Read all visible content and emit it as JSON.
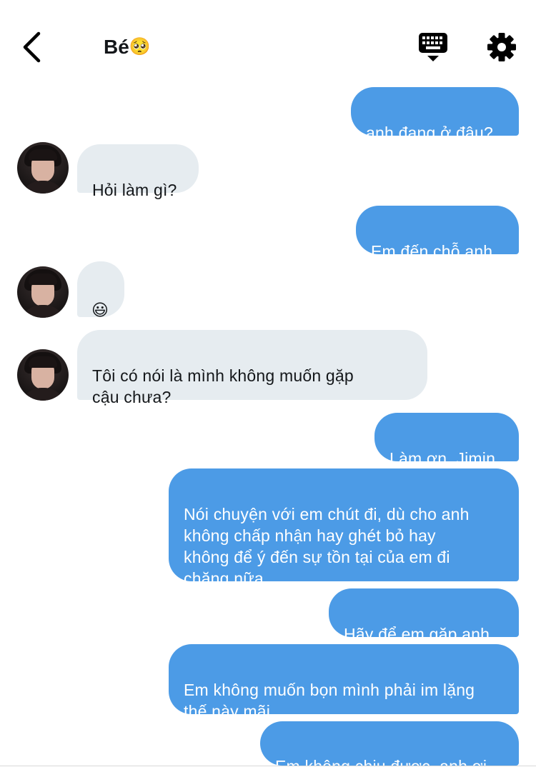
{
  "header": {
    "title": "Bé",
    "title_emoji": "🥺",
    "back_icon": "chevron-left-icon",
    "keyboard_icon": "keyboard-icon",
    "settings_icon": "gear-icon"
  },
  "messages": [
    {
      "direction": "out",
      "text": "anh đang ở đâu?"
    },
    {
      "direction": "in",
      "text": "Hỏi làm gì?"
    },
    {
      "direction": "out",
      "text": "Em đến chỗ anh"
    },
    {
      "direction": "in",
      "text": "😃"
    },
    {
      "direction": "in",
      "text": "Tôi có nói là mình không muốn gặp\ncậu chưa?"
    },
    {
      "direction": "out",
      "text": "Làm ơn, Jimin"
    },
    {
      "direction": "out",
      "text": "Nói chuyện với em chút đi, dù cho anh\nkhông chấp nhận hay ghét bỏ hay\nkhông để ý đến sự tồn tại của em đi\nchăng nữa"
    },
    {
      "direction": "out",
      "text": "Hãy để em gặp anh"
    },
    {
      "direction": "out",
      "text": "Em không muốn bọn mình phải im lặng\nthế này mãi"
    },
    {
      "direction": "out",
      "text": "Em không chịu được, anh ơi"
    }
  ],
  "colors": {
    "outgoing_bubble": "#4c9be6",
    "incoming_bubble": "#e6ecf0",
    "outgoing_text": "#ffffff",
    "incoming_text": "#14171a"
  }
}
